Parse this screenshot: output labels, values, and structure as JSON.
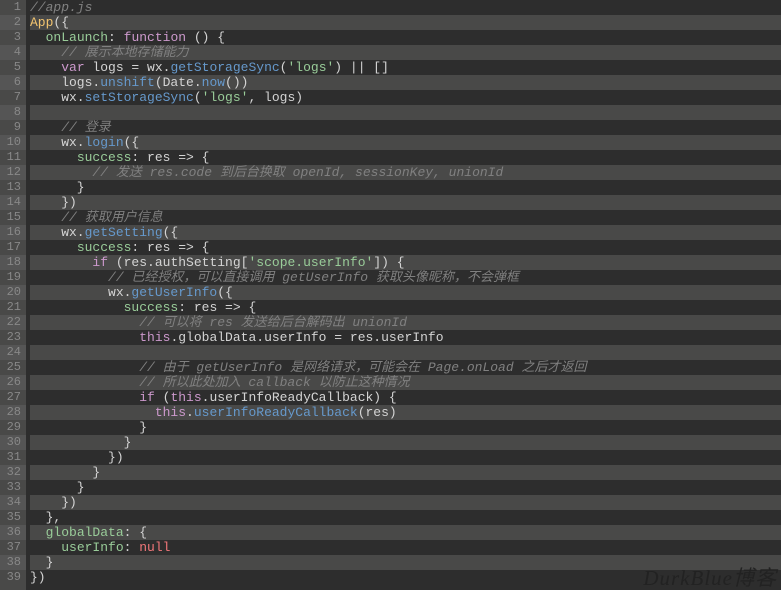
{
  "watermark": "DurkBlue博客",
  "lines": [
    {
      "num": 1,
      "hl": false,
      "tokens": [
        {
          "c": "comment",
          "t": "//app.js"
        }
      ]
    },
    {
      "num": 2,
      "hl": true,
      "tokens": [
        {
          "c": "func",
          "t": "App"
        },
        {
          "c": "punct",
          "t": "({"
        }
      ]
    },
    {
      "num": 3,
      "hl": false,
      "tokens": [
        {
          "c": "var",
          "t": "  "
        },
        {
          "c": "prop",
          "t": "onLaunch"
        },
        {
          "c": "punct",
          "t": ": "
        },
        {
          "c": "keyword",
          "t": "function"
        },
        {
          "c": "punct",
          "t": " () {"
        }
      ]
    },
    {
      "num": 4,
      "hl": true,
      "tokens": [
        {
          "c": "var",
          "t": "    "
        },
        {
          "c": "comment",
          "t": "// 展示本地存储能力"
        }
      ]
    },
    {
      "num": 5,
      "hl": false,
      "tokens": [
        {
          "c": "var",
          "t": "    "
        },
        {
          "c": "keyword",
          "t": "var"
        },
        {
          "c": "var",
          "t": " logs = wx."
        },
        {
          "c": "method",
          "t": "getStorageSync"
        },
        {
          "c": "punct",
          "t": "("
        },
        {
          "c": "string",
          "t": "'logs'"
        },
        {
          "c": "punct",
          "t": ") || []"
        }
      ]
    },
    {
      "num": 6,
      "hl": true,
      "tokens": [
        {
          "c": "var",
          "t": "    logs."
        },
        {
          "c": "method",
          "t": "unshift"
        },
        {
          "c": "punct",
          "t": "(Date."
        },
        {
          "c": "method",
          "t": "now"
        },
        {
          "c": "punct",
          "t": "())"
        }
      ]
    },
    {
      "num": 7,
      "hl": false,
      "tokens": [
        {
          "c": "var",
          "t": "    wx."
        },
        {
          "c": "method",
          "t": "setStorageSync"
        },
        {
          "c": "punct",
          "t": "("
        },
        {
          "c": "string",
          "t": "'logs'"
        },
        {
          "c": "punct",
          "t": ", logs)"
        }
      ]
    },
    {
      "num": 8,
      "hl": true,
      "tokens": []
    },
    {
      "num": 9,
      "hl": false,
      "tokens": [
        {
          "c": "var",
          "t": "    "
        },
        {
          "c": "comment",
          "t": "// 登录"
        }
      ]
    },
    {
      "num": 10,
      "hl": true,
      "tokens": [
        {
          "c": "var",
          "t": "    wx."
        },
        {
          "c": "method",
          "t": "login"
        },
        {
          "c": "punct",
          "t": "({"
        }
      ]
    },
    {
      "num": 11,
      "hl": false,
      "tokens": [
        {
          "c": "var",
          "t": "      "
        },
        {
          "c": "prop",
          "t": "success"
        },
        {
          "c": "punct",
          "t": ": "
        },
        {
          "c": "var",
          "t": "res"
        },
        {
          "c": "punct",
          "t": " => {"
        }
      ]
    },
    {
      "num": 12,
      "hl": true,
      "tokens": [
        {
          "c": "var",
          "t": "        "
        },
        {
          "c": "comment",
          "t": "// 发送 res.code 到后台换取 openId, sessionKey, unionId"
        }
      ]
    },
    {
      "num": 13,
      "hl": false,
      "tokens": [
        {
          "c": "punct",
          "t": "      }"
        }
      ]
    },
    {
      "num": 14,
      "hl": true,
      "tokens": [
        {
          "c": "punct",
          "t": "    })"
        }
      ]
    },
    {
      "num": 15,
      "hl": false,
      "tokens": [
        {
          "c": "var",
          "t": "    "
        },
        {
          "c": "comment",
          "t": "// 获取用户信息"
        }
      ]
    },
    {
      "num": 16,
      "hl": true,
      "tokens": [
        {
          "c": "var",
          "t": "    wx."
        },
        {
          "c": "method",
          "t": "getSetting"
        },
        {
          "c": "punct",
          "t": "({"
        }
      ]
    },
    {
      "num": 17,
      "hl": false,
      "tokens": [
        {
          "c": "var",
          "t": "      "
        },
        {
          "c": "prop",
          "t": "success"
        },
        {
          "c": "punct",
          "t": ": "
        },
        {
          "c": "var",
          "t": "res"
        },
        {
          "c": "punct",
          "t": " => {"
        }
      ]
    },
    {
      "num": 18,
      "hl": true,
      "tokens": [
        {
          "c": "var",
          "t": "        "
        },
        {
          "c": "keyword",
          "t": "if"
        },
        {
          "c": "punct",
          "t": " (res."
        },
        {
          "c": "var",
          "t": "authSetting"
        },
        {
          "c": "punct",
          "t": "["
        },
        {
          "c": "string",
          "t": "'scope.userInfo'"
        },
        {
          "c": "punct",
          "t": "]) {"
        }
      ]
    },
    {
      "num": 19,
      "hl": false,
      "tokens": [
        {
          "c": "var",
          "t": "          "
        },
        {
          "c": "comment",
          "t": "// 已经授权，可以直接调用 getUserInfo 获取头像昵称，不会弹框"
        }
      ]
    },
    {
      "num": 20,
      "hl": true,
      "tokens": [
        {
          "c": "var",
          "t": "          wx."
        },
        {
          "c": "method",
          "t": "getUserInfo"
        },
        {
          "c": "punct",
          "t": "({"
        }
      ]
    },
    {
      "num": 21,
      "hl": false,
      "tokens": [
        {
          "c": "var",
          "t": "            "
        },
        {
          "c": "prop",
          "t": "success"
        },
        {
          "c": "punct",
          "t": ": "
        },
        {
          "c": "var",
          "t": "res"
        },
        {
          "c": "punct",
          "t": " => {"
        }
      ]
    },
    {
      "num": 22,
      "hl": true,
      "tokens": [
        {
          "c": "var",
          "t": "              "
        },
        {
          "c": "comment",
          "t": "// 可以将 res 发送给后台解码出 unionId"
        }
      ]
    },
    {
      "num": 23,
      "hl": false,
      "tokens": [
        {
          "c": "var",
          "t": "              "
        },
        {
          "c": "this",
          "t": "this"
        },
        {
          "c": "punct",
          "t": "."
        },
        {
          "c": "var",
          "t": "globalData"
        },
        {
          "c": "punct",
          "t": "."
        },
        {
          "c": "var",
          "t": "userInfo"
        },
        {
          "c": "punct",
          "t": " = res."
        },
        {
          "c": "var",
          "t": "userInfo"
        }
      ]
    },
    {
      "num": 24,
      "hl": true,
      "tokens": []
    },
    {
      "num": 25,
      "hl": false,
      "tokens": [
        {
          "c": "var",
          "t": "              "
        },
        {
          "c": "comment",
          "t": "// 由于 getUserInfo 是网络请求，可能会在 Page.onLoad 之后才返回"
        }
      ]
    },
    {
      "num": 26,
      "hl": true,
      "tokens": [
        {
          "c": "var",
          "t": "              "
        },
        {
          "c": "comment",
          "t": "// 所以此处加入 callback 以防止这种情况"
        }
      ]
    },
    {
      "num": 27,
      "hl": false,
      "tokens": [
        {
          "c": "var",
          "t": "              "
        },
        {
          "c": "keyword",
          "t": "if"
        },
        {
          "c": "punct",
          "t": " ("
        },
        {
          "c": "this",
          "t": "this"
        },
        {
          "c": "punct",
          "t": "."
        },
        {
          "c": "var",
          "t": "userInfoReadyCallback"
        },
        {
          "c": "punct",
          "t": ") {"
        }
      ]
    },
    {
      "num": 28,
      "hl": true,
      "tokens": [
        {
          "c": "var",
          "t": "                "
        },
        {
          "c": "this",
          "t": "this"
        },
        {
          "c": "punct",
          "t": "."
        },
        {
          "c": "method",
          "t": "userInfoReadyCallback"
        },
        {
          "c": "punct",
          "t": "(res)"
        }
      ]
    },
    {
      "num": 29,
      "hl": false,
      "tokens": [
        {
          "c": "punct",
          "t": "              }"
        }
      ]
    },
    {
      "num": 30,
      "hl": true,
      "tokens": [
        {
          "c": "punct",
          "t": "            }"
        }
      ]
    },
    {
      "num": 31,
      "hl": false,
      "tokens": [
        {
          "c": "punct",
          "t": "          })"
        }
      ]
    },
    {
      "num": 32,
      "hl": true,
      "tokens": [
        {
          "c": "punct",
          "t": "        }"
        }
      ]
    },
    {
      "num": 33,
      "hl": false,
      "tokens": [
        {
          "c": "punct",
          "t": "      }"
        }
      ]
    },
    {
      "num": 34,
      "hl": true,
      "tokens": [
        {
          "c": "punct",
          "t": "    })"
        }
      ]
    },
    {
      "num": 35,
      "hl": false,
      "tokens": [
        {
          "c": "punct",
          "t": "  },"
        }
      ]
    },
    {
      "num": 36,
      "hl": true,
      "tokens": [
        {
          "c": "var",
          "t": "  "
        },
        {
          "c": "prop",
          "t": "globalData"
        },
        {
          "c": "punct",
          "t": ": {"
        }
      ]
    },
    {
      "num": 37,
      "hl": false,
      "tokens": [
        {
          "c": "var",
          "t": "    "
        },
        {
          "c": "prop",
          "t": "userInfo"
        },
        {
          "c": "punct",
          "t": ": "
        },
        {
          "c": "num",
          "t": "null"
        }
      ]
    },
    {
      "num": 38,
      "hl": true,
      "tokens": [
        {
          "c": "punct",
          "t": "  }"
        }
      ]
    },
    {
      "num": 39,
      "hl": false,
      "tokens": [
        {
          "c": "punct",
          "t": "})"
        }
      ]
    }
  ]
}
